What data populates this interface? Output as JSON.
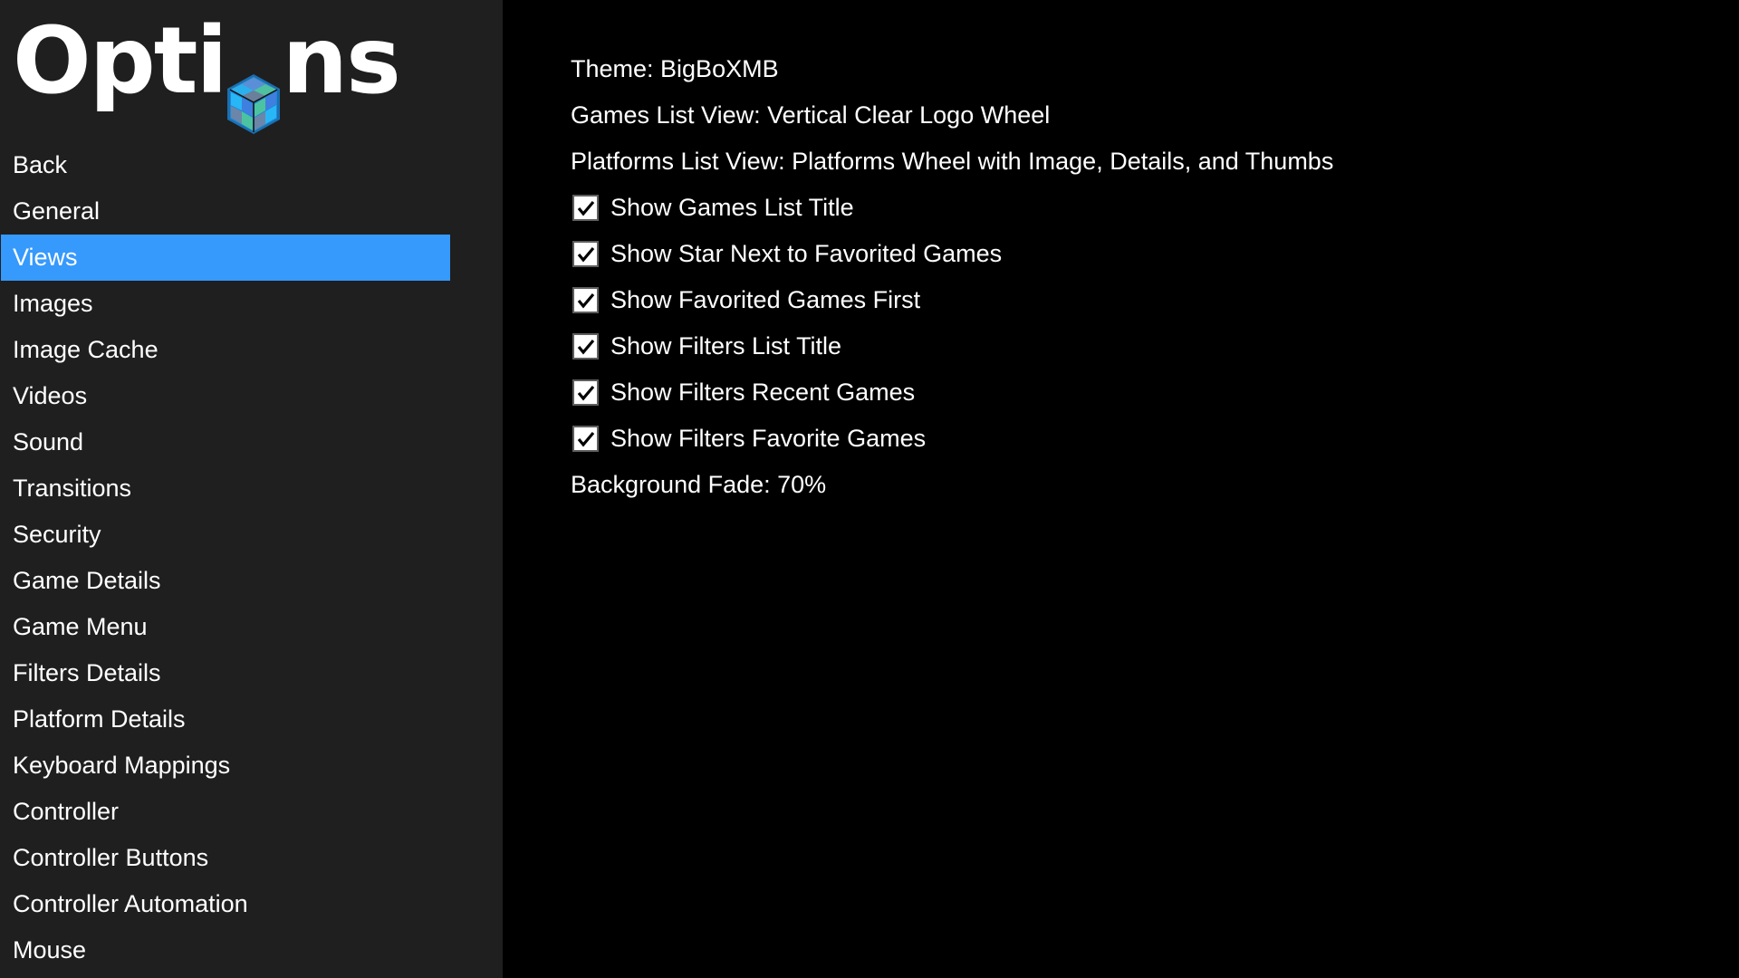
{
  "header": {
    "title_left": "Opti",
    "title_right": "ns",
    "logo_icon": "cube-logo-icon"
  },
  "sidebar": {
    "selected_index": 2,
    "accent_color": "#3699fc",
    "items": [
      {
        "label": "Back"
      },
      {
        "label": "General"
      },
      {
        "label": "Views"
      },
      {
        "label": "Images"
      },
      {
        "label": "Image Cache"
      },
      {
        "label": "Videos"
      },
      {
        "label": "Sound"
      },
      {
        "label": "Transitions"
      },
      {
        "label": "Security"
      },
      {
        "label": "Game Details"
      },
      {
        "label": "Game Menu"
      },
      {
        "label": "Filters Details"
      },
      {
        "label": "Platform Details"
      },
      {
        "label": "Keyboard Mappings"
      },
      {
        "label": "Controller"
      },
      {
        "label": "Controller Buttons"
      },
      {
        "label": "Controller Automation"
      },
      {
        "label": "Mouse"
      }
    ]
  },
  "main": {
    "theme": "Theme: BigBoXMB",
    "games_list_view": "Games List View: Vertical Clear Logo Wheel",
    "platforms_list_view": "Platforms List View: Platforms Wheel with Image, Details, and Thumbs",
    "checkboxes": [
      {
        "label": "Show Games List Title",
        "checked": true
      },
      {
        "label": "Show Star Next to Favorited Games",
        "checked": true
      },
      {
        "label": "Show Favorited Games First",
        "checked": true
      },
      {
        "label": "Show Filters List Title",
        "checked": true
      },
      {
        "label": "Show Filters Recent Games",
        "checked": true
      },
      {
        "label": "Show Filters Favorite Games",
        "checked": true
      }
    ],
    "background_fade": "Background Fade: 70%"
  }
}
